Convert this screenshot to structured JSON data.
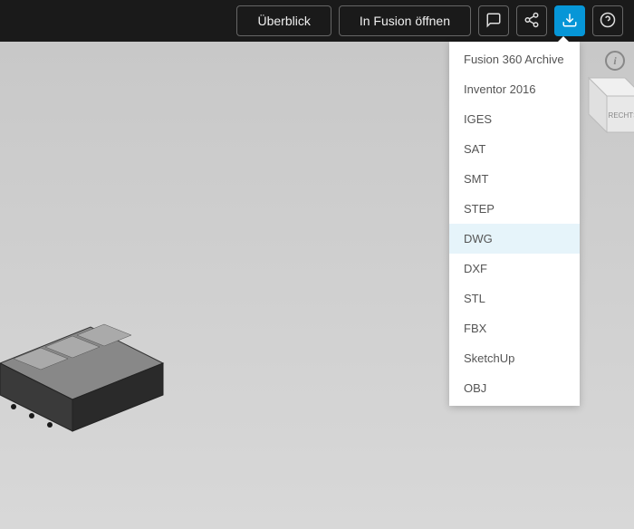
{
  "toolbar": {
    "overview_label": "Überblick",
    "open_fusion_label": "In Fusion öffnen"
  },
  "dropdown": {
    "items": [
      {
        "label": "Fusion 360 Archive",
        "selected": false
      },
      {
        "label": "Inventor 2016",
        "selected": false
      },
      {
        "label": "IGES",
        "selected": false
      },
      {
        "label": "SAT",
        "selected": false
      },
      {
        "label": "SMT",
        "selected": false
      },
      {
        "label": "STEP",
        "selected": false
      },
      {
        "label": "DWG",
        "selected": true
      },
      {
        "label": "DXF",
        "selected": false
      },
      {
        "label": "STL",
        "selected": false
      },
      {
        "label": "FBX",
        "selected": false
      },
      {
        "label": "SketchUp",
        "selected": false
      },
      {
        "label": "OBJ",
        "selected": false
      }
    ]
  },
  "viewcube": {
    "face_label": "RECHTS"
  },
  "colors": {
    "toolbar_bg": "#1a1a1a",
    "accent": "#0696d7",
    "dropdown_hover": "#e6f4fa"
  }
}
